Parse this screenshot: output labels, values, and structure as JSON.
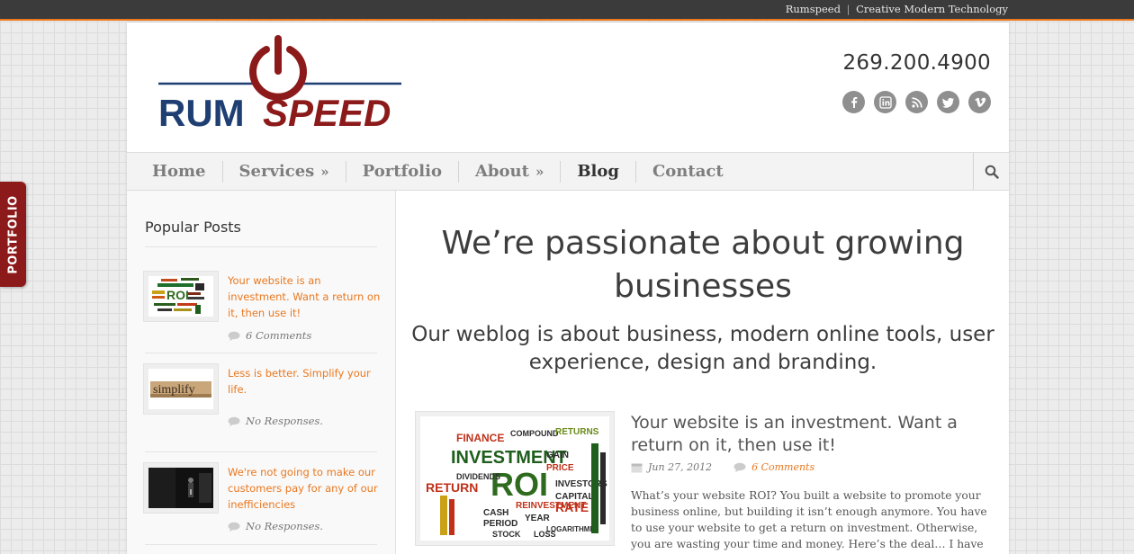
{
  "top_bar": {
    "brand": "Rumspeed",
    "separator": "|",
    "tagline": "Creative Modern Technology"
  },
  "header": {
    "logo_text": {
      "rum": "RUM",
      "speed": "SPEED"
    },
    "phone": "269.200.4900",
    "social_icons": [
      "facebook-icon",
      "linkedin-icon",
      "rss-icon",
      "twitter-icon",
      "vimeo-icon"
    ]
  },
  "nav": {
    "items": [
      {
        "label": "Home",
        "has_submenu": false
      },
      {
        "label": "Services",
        "has_submenu": true
      },
      {
        "label": "Portfolio",
        "has_submenu": false
      },
      {
        "label": "About",
        "has_submenu": true
      },
      {
        "label": "Blog",
        "has_submenu": false,
        "active": true
      },
      {
        "label": "Contact",
        "has_submenu": false
      }
    ],
    "submenu_glyph": "»",
    "search_icon": "search-icon"
  },
  "sidebar": {
    "heading": "Popular Posts",
    "posts": [
      {
        "title": "Your website is an investment. Want a return on it, then use it!",
        "meta": "6 Comments"
      },
      {
        "title": "Less is better. Simplify your life.",
        "meta": "No Responses."
      },
      {
        "title": "We're not going to make our customers pay for any of our inefficiencies",
        "meta": "No Responses."
      }
    ]
  },
  "main": {
    "hero_title": "We’re passionate about growing businesses",
    "hero_subtitle": "Our weblog is about business, modern online tools, user experience, design and branding.",
    "post": {
      "title": "Your website is an investment. Want a return on it, then use it!",
      "date": "Jun 27, 2012",
      "comments": "6 Comments",
      "excerpt": "What’s your website ROI? You built a website to promote your business online, but building it isn’t enough anymore. You have to use your website to get a return on investment. Otherwise, you are wasting your time and money.   Here’s the deal… I have"
    }
  },
  "side_tab": {
    "label": "PORTFOLIO"
  },
  "colors": {
    "accent": "#e9781f",
    "logo_red": "#8c1a1a",
    "logo_blue": "#1f3f73",
    "topbar": "#3b3b3b"
  }
}
